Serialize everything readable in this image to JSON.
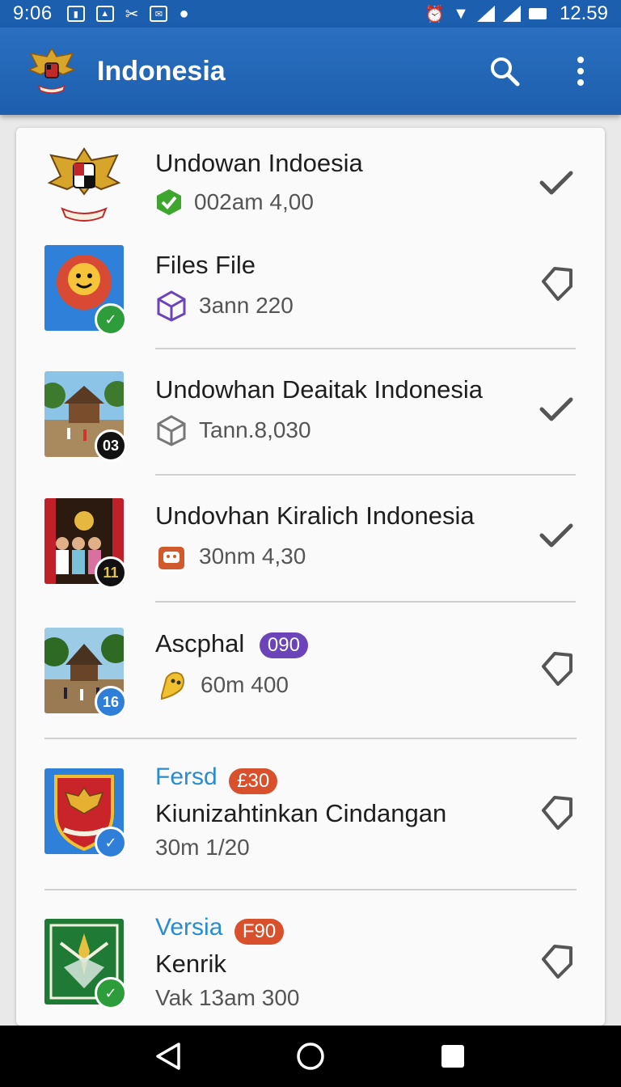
{
  "status_bar": {
    "time": "9:06",
    "clock": "12.59"
  },
  "app_bar": {
    "title": "Indonesia"
  },
  "items": [
    {
      "title": "Undowan Indoesia",
      "subtitle": "002am 4,00",
      "sub_icon": "shield-check-icon",
      "trailing": "check-icon"
    },
    {
      "title": "Files File",
      "subtitle": "3ann 220",
      "sub_icon": "cube-icon",
      "trailing": "tag-icon"
    },
    {
      "title": "Undowhan Deaitak Indonesia",
      "subtitle": "Tann.8,030",
      "sub_icon": "cube-outline-icon",
      "trailing": "check-icon",
      "badge": "03"
    },
    {
      "title": "Undovhan Kiralich Indonesia",
      "subtitle": "30nm 4,30",
      "sub_icon": "bag-icon",
      "trailing": "check-icon",
      "badge": "11"
    },
    {
      "title": "Ascphal",
      "tag": "090",
      "subtitle": "60m 400",
      "sub_icon": "ghost-icon",
      "trailing": "tag-icon",
      "badge": "16"
    },
    {
      "label": "Fersd",
      "tag": "£30",
      "title": "Kiunizahtinkan Cindangan",
      "subtitle": "30m 1/20",
      "trailing": "tag-icon"
    },
    {
      "label": "Versia",
      "tag": "F90",
      "title": "Kenrik",
      "subtitle": "Vak 13am 300",
      "trailing": "tag-icon"
    }
  ],
  "colors": {
    "primary": "#1d5fae",
    "badge_green": "#2d9c3a",
    "badge_blue": "#2f7fd8",
    "tag_purple": "#6a44b8",
    "tag_red": "#d8502c",
    "label_blue": "#2a8ccf"
  }
}
